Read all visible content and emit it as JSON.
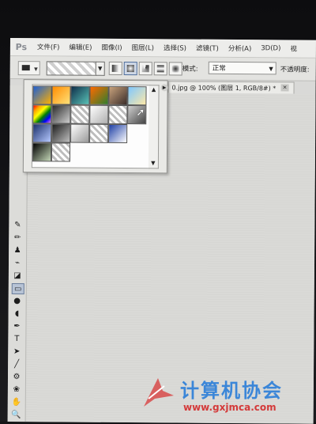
{
  "app": {
    "logo": "Ps"
  },
  "menu": [
    "文件(F)",
    "编辑(E)",
    "图像(I)",
    "图层(L)",
    "选择(S)",
    "滤镜(T)",
    "分析(A)",
    "3D(D)",
    "视"
  ],
  "options_bar": {
    "mode_label": "模式:",
    "mode_value": "正常",
    "opacity_label": "不透明度:",
    "gradient_types": [
      "linear-gradient-icon",
      "radial-gradient-icon",
      "angle-gradient-icon",
      "reflected-gradient-icon",
      "diamond-gradient-icon"
    ],
    "active_gradient_type": 1
  },
  "document": {
    "tab_title": "0.jpg @ 100% (图层 1, RGB/8#) *",
    "close": "×"
  },
  "gradient_picker": {
    "presets": [
      [
        "#1b5fd6",
        "#ffb000"
      ],
      [
        "#ff8c00",
        "#ffe27a"
      ],
      [
        "#0f2f4a",
        "#59c2b7"
      ],
      [
        "#ff6a00",
        "#2d7d2d"
      ],
      [
        "#c8a27c",
        "#3a2d2a"
      ],
      [
        "#7ec7ff",
        "#ffe9a8"
      ],
      [
        "rainbow",
        "rainbow"
      ],
      [
        "#2a2a2a",
        "#cfcfcf"
      ],
      [
        "transparent",
        "transparent"
      ],
      [
        "#ffffff",
        "#b0b0b0"
      ],
      [
        "transparent",
        "transparent"
      ],
      [
        "#cfcfcf",
        "#444444"
      ],
      [
        "#1a2f6b",
        "#b6c9ff"
      ],
      [
        "#1c1c1c",
        "#bfbfbf"
      ],
      [
        "#ffffff",
        "#9a9a9a"
      ],
      [
        "transparent",
        "transparent"
      ],
      [
        "#1e3fa6",
        "#ffffff"
      ],
      [
        "",
        ""
      ],
      [
        "#000000",
        "#c3d6b6"
      ],
      [
        "transparent",
        "transparent"
      ],
      [
        "",
        ""
      ],
      [
        "",
        ""
      ],
      [
        "",
        ""
      ],
      [
        "",
        ""
      ]
    ]
  },
  "toolbox": [
    "brush-icon",
    "pencil-icon",
    "stamp-icon",
    "history-brush-icon",
    "eraser-icon",
    "gradient-icon",
    "blur-icon",
    "dodge-icon",
    "pen-icon",
    "type-icon",
    "path-select-icon",
    "line-icon",
    "3d-rotate-icon",
    "3d-orbit-icon",
    "hand-icon",
    "zoom-icon",
    "color-swatch-icon"
  ],
  "toolbox_glyphs": [
    "✎",
    "✏",
    "♟",
    "⌁",
    "◪",
    "▭",
    "●",
    "◖",
    "✒",
    "T",
    "➤",
    "╱",
    "⚙",
    "❀",
    "✋",
    "🔍",
    "■"
  ],
  "watermark": {
    "title": "计算机协会",
    "url": "www.gxjmca.com"
  }
}
